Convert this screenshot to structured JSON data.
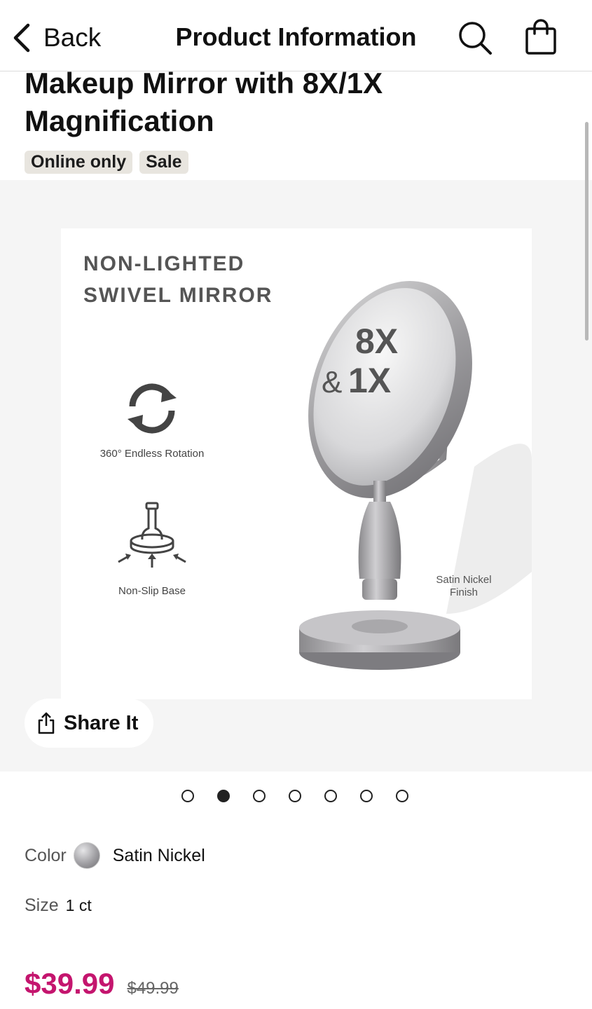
{
  "header": {
    "back_label": "Back",
    "title": "Product Information"
  },
  "product": {
    "title": "Makeup Mirror with 8X/1X Magnification",
    "badges": [
      "Online only",
      "Sale"
    ]
  },
  "image": {
    "headline_line1": "NON-LIGHTED",
    "headline_line2": "SWIVEL MIRROR",
    "feature_rotation": "360° Endless Rotation",
    "feature_base": "Non-Slip Base",
    "mag_top": "8X",
    "mag_amp": "&",
    "mag_bottom": "1X",
    "finish_line1": "Satin Nickel",
    "finish_line2": "Finish"
  },
  "share_label": "Share It",
  "carousel": {
    "total": 7,
    "active": 2
  },
  "options": {
    "color_label": "Color",
    "color_value": "Satin Nickel",
    "size_label": "Size",
    "size_value": "1 ct"
  },
  "price": {
    "sale": "$39.99",
    "original": "$49.99"
  },
  "colors": {
    "accent_price": "#c4156e",
    "gallery_bg": "#f5f5f5"
  },
  "icons": [
    "chevron-left-icon",
    "search-icon",
    "shopping-bag-icon",
    "rotate-icon",
    "non-slip-base-icon",
    "share-icon"
  ]
}
